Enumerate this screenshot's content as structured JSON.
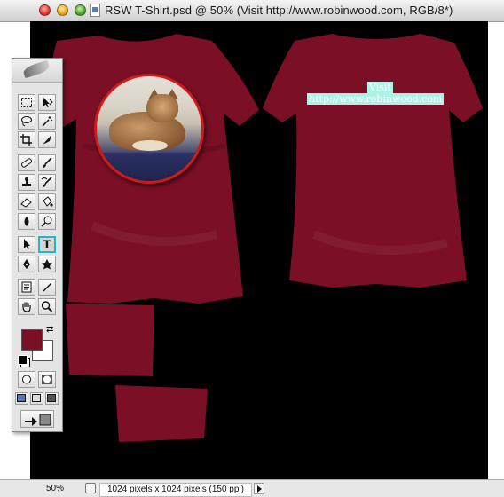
{
  "window": {
    "title": "RSW T-Shirt.psd @ 50% (Visit http://www.robinwood.com, RGB/8*)"
  },
  "canvas": {
    "background_color": "#000000",
    "shirt_color": "#7a0f25",
    "text_layer_line1": "Visit",
    "text_layer_line2": "http://www.robinwood.com",
    "text_highlight_color": "#aef1e6",
    "photo_border_color": "#d01a1a"
  },
  "status_bar": {
    "zoom": "50%",
    "document_info": "1024 pixels x 1024 pixels (150 ppi)"
  },
  "toolbox": {
    "active_tool": "type-tool",
    "foreground_color": "#7a0f25",
    "background_color": "#ffffff",
    "active_highlight_color": "#22b6c8",
    "type_tool_label": "T",
    "tools": [
      "marquee-tool",
      "move-tool",
      "lasso-tool",
      "magic-wand-tool",
      "crop-tool",
      "slice-tool",
      "healing-brush-tool",
      "brush-tool",
      "clone-stamp-tool",
      "history-brush-tool",
      "eraser-tool",
      "paint-bucket-tool",
      "blur-tool",
      "dodge-tool",
      "path-selection-tool",
      "type-tool",
      "pen-tool",
      "custom-shape-tool",
      "notes-tool",
      "eyedropper-tool",
      "hand-tool",
      "zoom-tool"
    ]
  }
}
